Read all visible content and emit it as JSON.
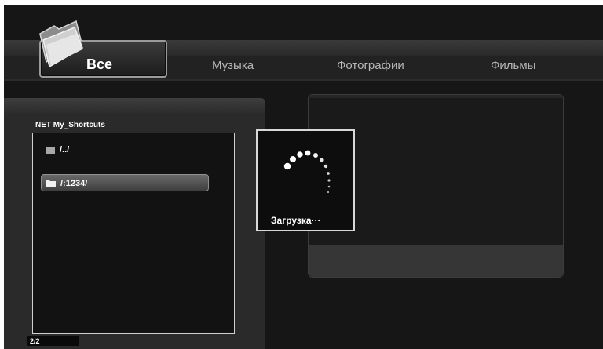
{
  "tabs": [
    {
      "label": "Все",
      "active": true,
      "icon": "folder-icon"
    },
    {
      "label": "Музыка",
      "active": false
    },
    {
      "label": "Фотографии",
      "active": false
    },
    {
      "label": "Фильмы",
      "active": false
    }
  ],
  "browser": {
    "path": "NET My_Shortcuts",
    "items": [
      {
        "label": "/../",
        "icon": "folder-icon",
        "selected": false
      },
      {
        "label": "/:1234/",
        "icon": "folder-icon",
        "selected": true
      }
    ],
    "page_counter": "2/2"
  },
  "loading": {
    "label": "Загрузка···",
    "icon": "spinner-icon"
  },
  "colors": {
    "background": "#161616",
    "panel": "#2a2a2a",
    "text": "#ffffff",
    "inactive_tab_text": "#b8b8b8",
    "border": "#cfcfcf"
  }
}
